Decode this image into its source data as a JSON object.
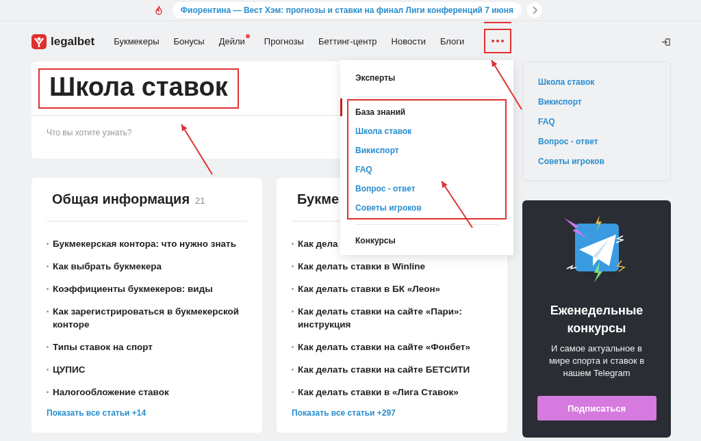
{
  "banner": {
    "text": "Фиорентина — Вест Хэм: прогнозы и ставки на финал Лиги конференций 7 июня"
  },
  "header": {
    "logo": "legalbet",
    "nav": [
      {
        "label": "Букмекеры",
        "badge": false
      },
      {
        "label": "Бонусы",
        "badge": false
      },
      {
        "label": "Дейли",
        "badge": true
      },
      {
        "label": "Прогнозы",
        "badge": false
      },
      {
        "label": "Беттинг-центр",
        "badge": false
      },
      {
        "label": "Новости",
        "badge": false
      },
      {
        "label": "Блоги",
        "badge": false
      }
    ],
    "more": {
      "expanded": true
    }
  },
  "hero": {
    "title": "Школа ставок",
    "search": {
      "placeholder": "Что вы хотите узнать?"
    }
  },
  "dropdown": {
    "sections": [
      {
        "highlighted": false,
        "items": [
          {
            "kind": "heading",
            "label": "Эксперты"
          }
        ]
      },
      {
        "highlighted": true,
        "items": [
          {
            "kind": "heading",
            "label": "База знаний"
          },
          {
            "kind": "link",
            "label": "Школа ставок"
          },
          {
            "kind": "link",
            "label": "Викиспорт"
          },
          {
            "kind": "link",
            "label": "FAQ"
          },
          {
            "kind": "link",
            "label": "Вопрос - ответ"
          },
          {
            "kind": "link",
            "label": "Советы игроков"
          }
        ]
      },
      {
        "highlighted": false,
        "items": [
          {
            "kind": "heading",
            "label": "Конкурсы"
          }
        ]
      }
    ]
  },
  "cards": [
    {
      "title": "Общая информация",
      "count": "21",
      "items": [
        "Букмекерская контора: что нужно знать",
        "Как выбрать букмекера",
        "Коэффициенты букмекеров: виды",
        "Как зарегистрироваться в букмекерской конторе",
        "Типы ставок на спорт",
        "ЦУПИС",
        "Налогообложение ставок"
      ],
      "more": "Показать все статьи +14"
    },
    {
      "title": "Букме",
      "items": [
        "Как дела",
        "Как делать ставки в Winline",
        "Как делать ставки в БК «Леон»",
        "Как делать ставки на сайте «Пари»: инструкция",
        "Как делать ставки на сайте «Фонбет»",
        "Как делать ставки на сайте БЕТСИТИ",
        "Как делать ставки в «Лига Ставок»"
      ],
      "more": "Показать все статьи +297"
    }
  ],
  "sidebar": {
    "links": [
      "Школа ставок",
      "Викиспорт",
      "FAQ",
      "Вопрос - ответ",
      "Советы игроков"
    ]
  },
  "promo": {
    "title": "Еженедельные конкурсы",
    "text": "И самое актуальное в мире спорта и ставок в нашем Telegram",
    "button": "Подписаться"
  }
}
